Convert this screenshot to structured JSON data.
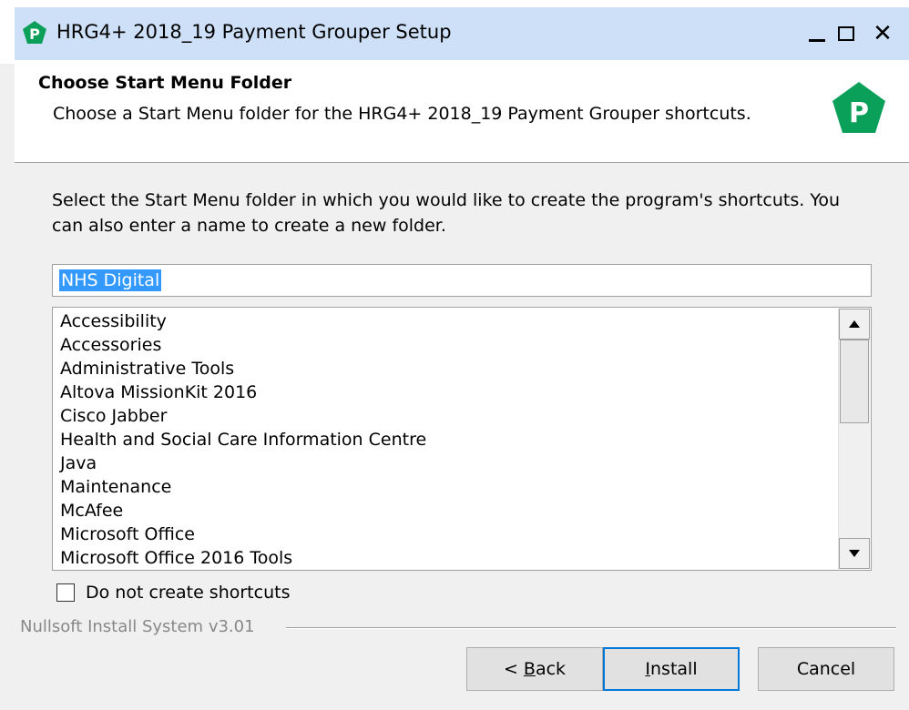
{
  "window": {
    "title": "HRG4+ 2018_19 Payment Grouper Setup",
    "app_icon": "green-p-pentagon-icon",
    "controls": {
      "minimize": "minimize-icon",
      "maximize": "maximize-icon",
      "close": "close-icon"
    }
  },
  "header": {
    "title": "Choose Start Menu Folder",
    "subtitle": "Choose a Start Menu folder for the HRG4+ 2018_19 Payment Grouper shortcuts.",
    "logo": "green-p-pentagon-icon"
  },
  "body": {
    "instructions": "Select the Start Menu folder in which you would like to create the program's shortcuts. You can also enter a name to create a new folder.",
    "folder_input_value": "NHS Digital",
    "folders": [
      "Accessibility",
      "Accessories",
      "Administrative Tools",
      "Altova MissionKit 2016",
      "Cisco Jabber",
      "Health and Social Care Information Centre",
      "Java",
      "Maintenance",
      "McAfee",
      "Microsoft Office",
      "Microsoft Office 2016 Tools"
    ],
    "no_shortcuts_label": "Do not create shortcuts",
    "no_shortcuts_checked": false
  },
  "footer": {
    "brand": "Nullsoft Install System v3.01",
    "back_prefix": "< ",
    "back_accel": "B",
    "back_rest": "ack",
    "install_accel": "I",
    "install_rest": "nstall",
    "cancel_label": "Cancel"
  },
  "colors": {
    "accent": "#0078d7",
    "titlebar": "#cde0f7",
    "logo_green": "#0aa05a",
    "selection": "#3399ff"
  }
}
